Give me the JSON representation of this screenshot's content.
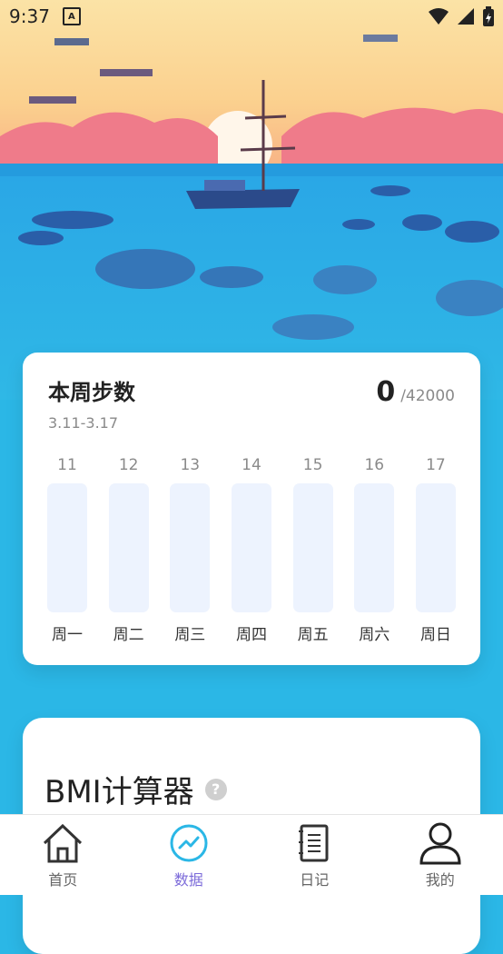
{
  "status_bar": {
    "time": "9:37",
    "notification_icon": "a-icon"
  },
  "steps_card": {
    "title": "本周步数",
    "date_range": "3.11-3.17",
    "current": "0",
    "goal": "/42000",
    "days": [
      {
        "date": "11",
        "weekday": "周一"
      },
      {
        "date": "12",
        "weekday": "周二"
      },
      {
        "date": "13",
        "weekday": "周三"
      },
      {
        "date": "14",
        "weekday": "周四"
      },
      {
        "date": "15",
        "weekday": "周五"
      },
      {
        "date": "16",
        "weekday": "周六"
      },
      {
        "date": "17",
        "weekday": "周日"
      }
    ]
  },
  "bmi_card": {
    "title": "BMI计算器",
    "help": "?"
  },
  "tabbar": [
    {
      "label": "首页",
      "icon": "home-icon"
    },
    {
      "label": "数据",
      "icon": "chart-icon",
      "active": true
    },
    {
      "label": "日记",
      "icon": "notebook-icon"
    },
    {
      "label": "我的",
      "icon": "user-icon"
    }
  ],
  "colors": {
    "accent": "#7b6ad9",
    "sky": "#2bb7e6",
    "bar": "#edf3fe"
  }
}
